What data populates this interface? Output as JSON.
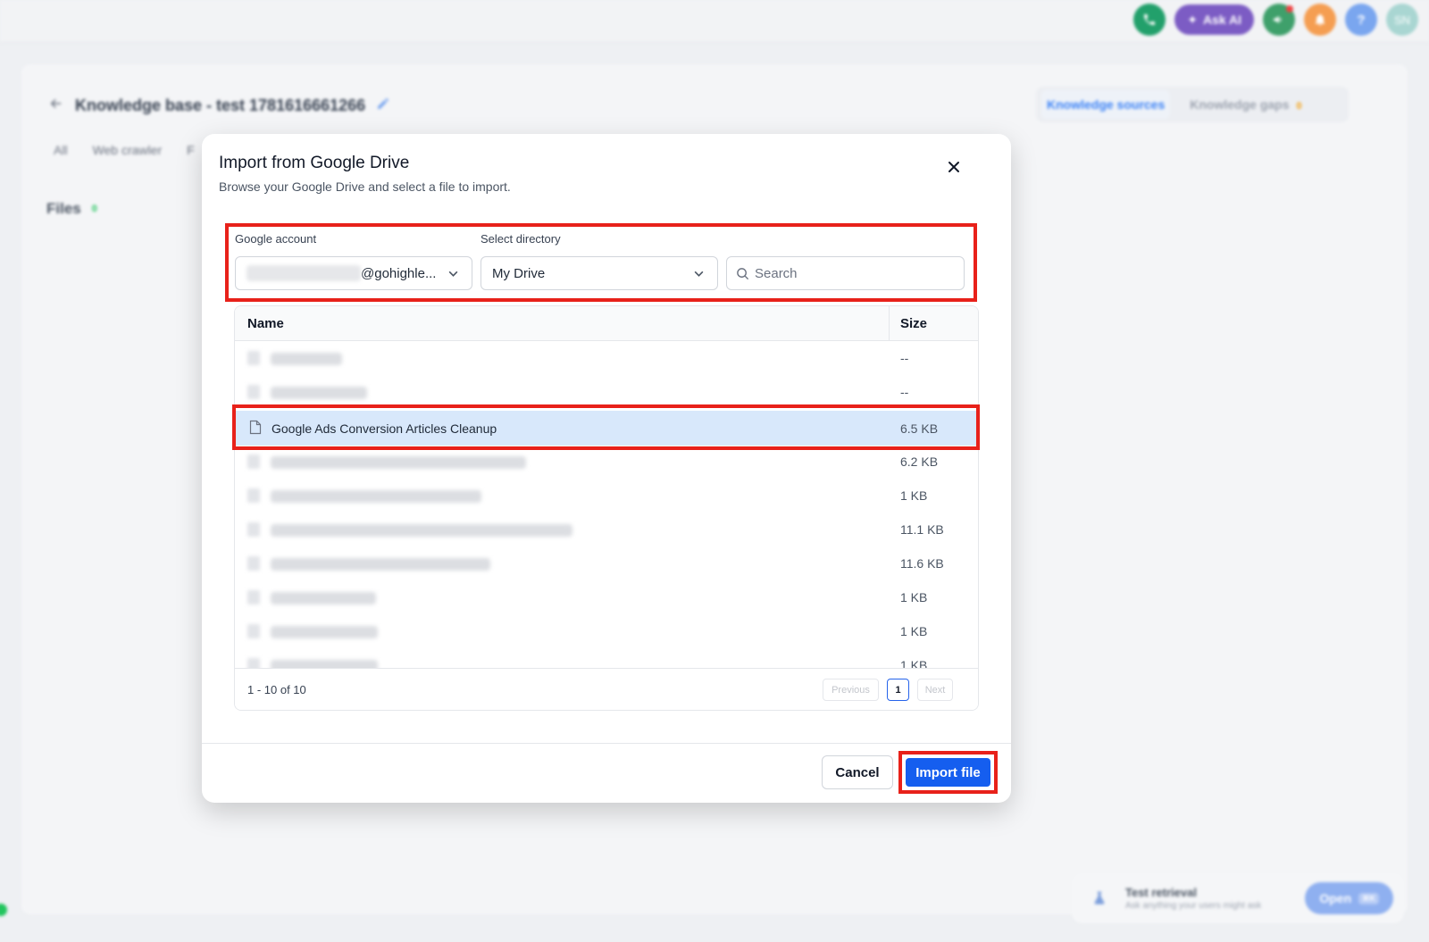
{
  "topbar": {
    "ask_ai_label": "Ask AI",
    "avatar_initials": "SN",
    "help_glyph": "?",
    "icons": [
      "phone-icon",
      "sparkle-icon",
      "megaphone-icon",
      "bell-icon",
      "help-icon",
      "avatar"
    ],
    "colors": {
      "phone": "#22a06b",
      "ask_ai": "#7c5cc4",
      "megaphone": "#3fa06b",
      "bell": "#f59e52",
      "help": "#7aa6ef",
      "avatar": "#a9d6d2"
    }
  },
  "kb": {
    "title": "Knowledge base - test 1781616661266",
    "tabs": [
      "All",
      "Web crawler",
      "F"
    ],
    "files_label": "Files",
    "files_count": "0",
    "right_tabs": {
      "sources": "Knowledge sources",
      "gaps": "Knowledge gaps",
      "gaps_count": "0"
    }
  },
  "test_retrieval": {
    "title": "Test retrieval",
    "subtitle": "Ask anything your users might ask",
    "open_label": "Open",
    "shortcut": "⌘K"
  },
  "modal": {
    "title": "Import from Google Drive",
    "subtitle": "Browse your Google Drive and select a file to import.",
    "account_label": "Google account",
    "account_value": "@gohighle...",
    "directory_label": "Select directory",
    "directory_value": "My Drive",
    "search_placeholder": "Search",
    "table": {
      "col_name": "Name",
      "col_size": "Size",
      "rows": [
        {
          "name": "",
          "size": "--"
        },
        {
          "name": "",
          "size": "--"
        },
        {
          "name": "Google Ads Conversion Articles Cleanup",
          "size": "6.5 KB",
          "selected": true
        },
        {
          "name": "",
          "size": "6.2 KB"
        },
        {
          "name": "",
          "size": "1 KB"
        },
        {
          "name": "",
          "size": "11.1 KB"
        },
        {
          "name": "",
          "size": "11.6 KB"
        },
        {
          "name": "",
          "size": "1 KB"
        },
        {
          "name": "",
          "size": "1 KB"
        },
        {
          "name": "",
          "size": "1 KB"
        }
      ]
    },
    "pagination": {
      "range": "1 - 10 of 10",
      "previous": "Previous",
      "current": "1",
      "next": "Next"
    },
    "cancel_label": "Cancel",
    "import_label": "Import file"
  }
}
